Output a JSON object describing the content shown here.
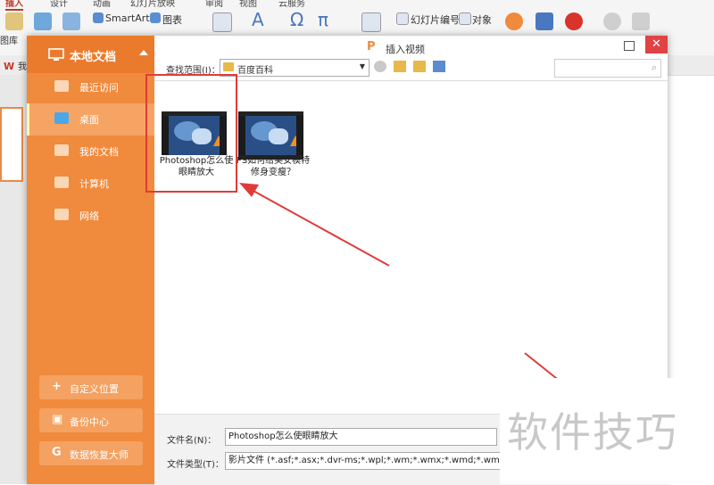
{
  "ribbon": {
    "tabs": [
      "插入",
      "设计",
      "动画",
      "幻灯片放映",
      "审阅",
      "视图",
      "云服务"
    ],
    "smartart_label": "SmartArt",
    "chart_label": "图表",
    "slide_number_label": "幻灯片编号",
    "object_label": "对象",
    "gallery_label": "图库",
    "doc_tab_label": "我的"
  },
  "dialog": {
    "title": "插入视频",
    "title_logo": "P",
    "close_glyph": "✕",
    "sidebar": {
      "header": "本地文档",
      "items": [
        {
          "label": "最近访问",
          "icon": "recent-icon"
        },
        {
          "label": "桌面",
          "icon": "desktop-icon"
        },
        {
          "label": "我的文档",
          "icon": "folder-icon"
        },
        {
          "label": "计算机",
          "icon": "computer-icon"
        },
        {
          "label": "网络",
          "icon": "network-icon"
        }
      ],
      "buttons": [
        {
          "label": "自定义位置",
          "icon": "+"
        },
        {
          "label": "备份中心",
          "icon": "▣"
        },
        {
          "label": "数据恢复大师",
          "icon": "G"
        }
      ]
    },
    "look_in_label": "查找范围(I)：",
    "look_in_value": "百度百科",
    "files": [
      {
        "name": "Photoshop怎么使眼睛放大"
      },
      {
        "name": "PS如何给美女模特修身变瘦？"
      }
    ],
    "filename_label": "文件名(N)：",
    "filename_value": "Photoshop怎么使眼睛放大",
    "filetype_label": "文件类型(T)：",
    "filetype_value": "影片文件 (*.asf;*.asx;*.dvr-ms;*.wpl;*.wm;*.wmx;*.wmd;*.wmz;*.avi;*.mo"
  },
  "watermark": "软件技巧",
  "colors": {
    "sidebar": "#f08a3c",
    "highlight": "#e03b3b",
    "accent": "#c0392b"
  }
}
